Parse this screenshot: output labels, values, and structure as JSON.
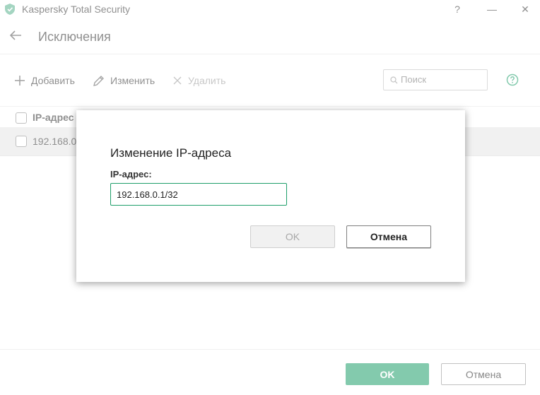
{
  "window": {
    "title": "Kaspersky Total Security",
    "help_glyph": "?",
    "minimize_glyph": "—",
    "close_glyph": "✕"
  },
  "header": {
    "title": "Исключения"
  },
  "toolbar": {
    "add_label": "Добавить",
    "edit_label": "Изменить",
    "delete_label": "Удалить",
    "search_placeholder": "Поиск"
  },
  "table": {
    "column_header": "IP-адрес",
    "rows": [
      {
        "ip": "192.168.0.1"
      }
    ]
  },
  "footer": {
    "ok_label": "OK",
    "cancel_label": "Отмена"
  },
  "dialog": {
    "title": "Изменение IP-адреса",
    "field_label": "IP-адрес:",
    "field_value": "192.168.0.1/32",
    "ok_label": "OK",
    "cancel_label": "Отмена"
  },
  "colors": {
    "accent": "#1e9e6a",
    "disabled_text": "#a8a8a8"
  },
  "icons": [
    "kaspersky-shield-icon",
    "back-arrow-icon",
    "plus-icon",
    "pencil-icon",
    "x-icon",
    "search-icon",
    "help-icon"
  ]
}
